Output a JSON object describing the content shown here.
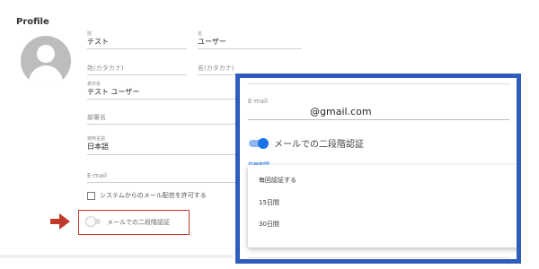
{
  "page_title": "Profile",
  "form": {
    "last_name": {
      "label": "姓",
      "value": "テスト"
    },
    "first_name": {
      "label": "名",
      "value": "ユーザー"
    },
    "last_name_kana": {
      "placeholder": "姓(カタカナ)"
    },
    "first_name_kana": {
      "placeholder": "名(カタカナ)"
    },
    "display_name": {
      "label": "表示名",
      "value": "テスト ユーザー"
    },
    "department": {
      "placeholder": "部署名"
    },
    "language": {
      "label": "使用言語",
      "value": "日本語"
    },
    "email": {
      "placeholder": "E-mail"
    },
    "allow_mail_label": "システムからのメール配信を許可する",
    "two_factor_label": "メールでの二段階認証"
  },
  "zoom": {
    "email_label": "E-mail",
    "email_value": "@gmail.com",
    "two_factor_label": "メールでの二段階認証",
    "period_label": "信頼期間",
    "options": [
      "毎回認証する",
      "15日間",
      "30日間"
    ]
  },
  "colors": {
    "highlight_box": "#c0392b",
    "arrow": "#c0392b",
    "zoom_border": "#2e5dbd",
    "toggle_on": "#1a73e8"
  }
}
